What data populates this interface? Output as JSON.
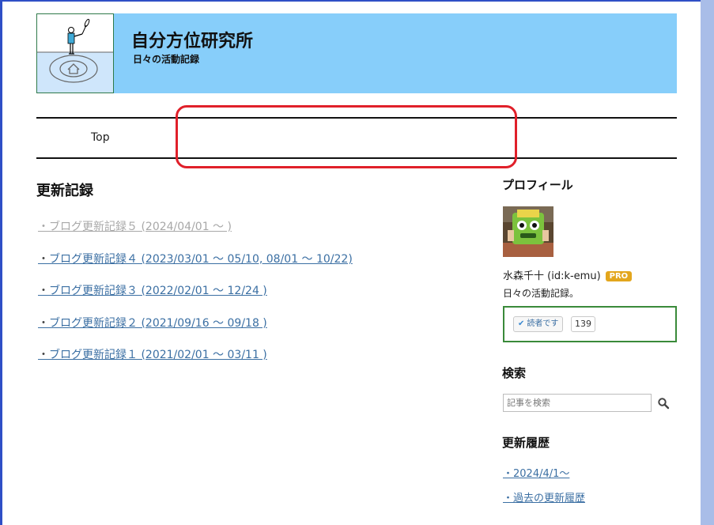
{
  "site": {
    "title": "自分方位研究所",
    "subtitle": "日々の活動記録"
  },
  "nav": {
    "items": [
      {
        "label": "Top"
      }
    ]
  },
  "main": {
    "heading": "更新記録",
    "bullet": "・",
    "records": [
      {
        "label": "ブログ更新記録５",
        "range": " (2024/04/01 ～ )",
        "dim": true
      },
      {
        "label": "ブログ更新記録４",
        "range": " (2023/03/01 ～ 05/10, 08/01 ～ 10/22)",
        "dim": false
      },
      {
        "label": "ブログ更新記録３",
        "range": " (2022/02/01 ～ 12/24 )",
        "dim": false
      },
      {
        "label": "ブログ更新記録２",
        "range": " (2021/09/16 ～ 09/18 )",
        "dim": false
      },
      {
        "label": "ブログ更新記録１",
        "range": " (2021/02/01 ～ 03/11 )",
        "dim": false
      }
    ]
  },
  "sidebar": {
    "profile": {
      "heading": "プロフィール",
      "name": "水森千十 (id:k-emu)",
      "badge": "PRO",
      "description": "日々の活動記録。",
      "reader_button": "読者です",
      "reader_count": "139"
    },
    "search": {
      "heading": "検索",
      "placeholder": "記事を検索"
    },
    "updates": {
      "heading": "更新履歴",
      "links": [
        "・2024/4/1～",
        "・過去の更新履歴"
      ]
    }
  },
  "colors": {
    "header_bg": "#87cefa",
    "link": "#3b6fa3",
    "annotation_red": "#e0202a",
    "reader_box_border": "#3a8a3a",
    "pro_badge": "#e3a61d"
  }
}
